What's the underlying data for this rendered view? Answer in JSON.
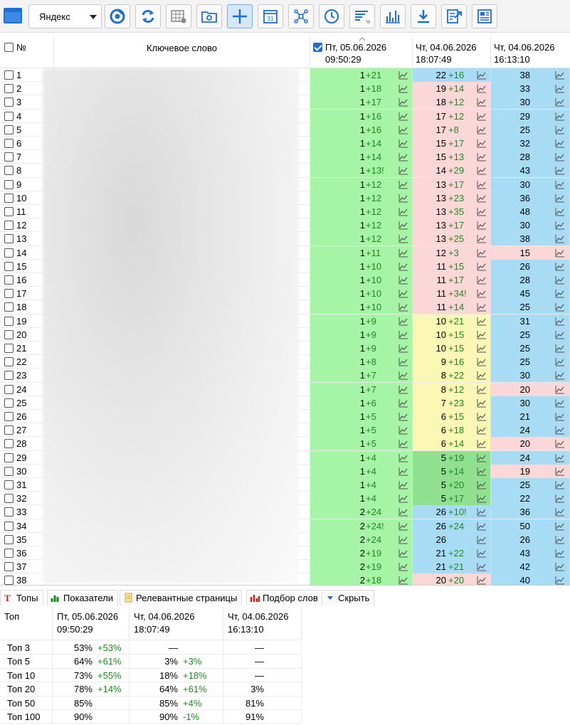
{
  "toolbar": {
    "search_engine": "Яндекс",
    "buttons": [
      "browser-icon",
      "refresh-icon",
      "table-settings-icon",
      "folder-settings-icon",
      "add-icon",
      "calendar-icon",
      "network-icon",
      "clock-icon",
      "filter-percent-icon",
      "chart-settings-icon",
      "download-icon",
      "export-icon",
      "report-icon"
    ],
    "calendar_day": "31"
  },
  "grid": {
    "headers": {
      "num": "№",
      "keyword": "Ключевое слово",
      "p1_date": "Пт, 05.06.2026",
      "p1_time": "09:50:29",
      "p2_date": "Чт, 04.06.2026",
      "p2_time": "18:07:49",
      "p3_date": "Чт, 04.06.2026",
      "p3_time": "16:13:10"
    },
    "rows": [
      {
        "n": "1",
        "p1": "1",
        "d1": "+21",
        "p2": "22",
        "d2": "+16",
        "c2": "blue",
        "p3": "38",
        "c3": "blue"
      },
      {
        "n": "2",
        "p1": "1",
        "d1": "+18",
        "p2": "19",
        "d2": "+14",
        "c2": "pink",
        "p3": "33",
        "c3": "blue"
      },
      {
        "n": "3",
        "p1": "1",
        "d1": "+17",
        "p2": "18",
        "d2": "+12",
        "c2": "pink",
        "p3": "30",
        "c3": "blue"
      },
      {
        "n": "4",
        "p1": "1",
        "d1": "+16",
        "p2": "17",
        "d2": "+12",
        "c2": "pink",
        "p3": "29",
        "c3": "blue"
      },
      {
        "n": "5",
        "p1": "1",
        "d1": "+16",
        "p2": "17",
        "d2": "+8",
        "c2": "pink",
        "p3": "25",
        "c3": "blue"
      },
      {
        "n": "6",
        "p1": "1",
        "d1": "+14",
        "p2": "15",
        "d2": "+17",
        "c2": "pink",
        "p3": "32",
        "c3": "blue"
      },
      {
        "n": "7",
        "p1": "1",
        "d1": "+14",
        "p2": "15",
        "d2": "+13",
        "c2": "pink",
        "p3": "28",
        "c3": "blue"
      },
      {
        "n": "8",
        "p1": "1",
        "d1": "+13!",
        "p2": "14",
        "d2": "+29",
        "c2": "pink",
        "p3": "43",
        "c3": "blue"
      },
      {
        "n": "9",
        "p1": "1",
        "d1": "+12",
        "p2": "13",
        "d2": "+17",
        "c2": "pink",
        "p3": "30",
        "c3": "blue"
      },
      {
        "n": "10",
        "p1": "1",
        "d1": "+12",
        "p2": "13",
        "d2": "+23",
        "c2": "pink",
        "p3": "36",
        "c3": "blue"
      },
      {
        "n": "11",
        "p1": "1",
        "d1": "+12",
        "p2": "13",
        "d2": "+35",
        "c2": "pink",
        "p3": "48",
        "c3": "blue"
      },
      {
        "n": "12",
        "p1": "1",
        "d1": "+12",
        "p2": "13",
        "d2": "+17",
        "c2": "pink",
        "p3": "30",
        "c3": "blue"
      },
      {
        "n": "13",
        "p1": "1",
        "d1": "+12",
        "p2": "13",
        "d2": "+25",
        "c2": "pink",
        "p3": "38",
        "c3": "blue"
      },
      {
        "n": "14",
        "p1": "1",
        "d1": "+11",
        "p2": "12",
        "d2": "+3",
        "c2": "pink",
        "p3": "15",
        "c3": "pink"
      },
      {
        "n": "15",
        "p1": "1",
        "d1": "+10",
        "p2": "11",
        "d2": "+15",
        "c2": "pink",
        "p3": "26",
        "c3": "blue"
      },
      {
        "n": "16",
        "p1": "1",
        "d1": "+10",
        "p2": "11",
        "d2": "+17",
        "c2": "pink",
        "p3": "28",
        "c3": "blue"
      },
      {
        "n": "17",
        "p1": "1",
        "d1": "+10",
        "p2": "11",
        "d2": "+34!",
        "c2": "pink",
        "p3": "45",
        "c3": "blue"
      },
      {
        "n": "18",
        "p1": "1",
        "d1": "+10",
        "p2": "11",
        "d2": "+14",
        "c2": "pink",
        "p3": "25",
        "c3": "blue"
      },
      {
        "n": "19",
        "p1": "1",
        "d1": "+9",
        "p2": "10",
        "d2": "+21",
        "c2": "yellow",
        "p3": "31",
        "c3": "blue"
      },
      {
        "n": "20",
        "p1": "1",
        "d1": "+9",
        "p2": "10",
        "d2": "+15",
        "c2": "yellow",
        "p3": "25",
        "c3": "blue"
      },
      {
        "n": "21",
        "p1": "1",
        "d1": "+9",
        "p2": "10",
        "d2": "+15",
        "c2": "yellow",
        "p3": "25",
        "c3": "blue"
      },
      {
        "n": "22",
        "p1": "1",
        "d1": "+8",
        "p2": "9",
        "d2": "+16",
        "c2": "yellow",
        "p3": "25",
        "c3": "blue"
      },
      {
        "n": "23",
        "p1": "1",
        "d1": "+7",
        "p2": "8",
        "d2": "+22",
        "c2": "yellow",
        "p3": "30",
        "c3": "blue"
      },
      {
        "n": "24",
        "p1": "1",
        "d1": "+7",
        "p2": "8",
        "d2": "+12",
        "c2": "yellow",
        "p3": "20",
        "c3": "pink"
      },
      {
        "n": "25",
        "p1": "1",
        "d1": "+6",
        "p2": "7",
        "d2": "+23",
        "c2": "yellow",
        "p3": "30",
        "c3": "blue"
      },
      {
        "n": "26",
        "p1": "1",
        "d1": "+5",
        "p2": "6",
        "d2": "+15",
        "c2": "yellow",
        "p3": "21",
        "c3": "blue"
      },
      {
        "n": "27",
        "p1": "1",
        "d1": "+5",
        "p2": "6",
        "d2": "+18",
        "c2": "yellow",
        "p3": "24",
        "c3": "blue"
      },
      {
        "n": "28",
        "p1": "1",
        "d1": "+5",
        "p2": "6",
        "d2": "+14",
        "c2": "yellow",
        "p3": "20",
        "c3": "pink"
      },
      {
        "n": "29",
        "p1": "1",
        "d1": "+4",
        "p2": "5",
        "d2": "+19",
        "c2": "dgreen",
        "p3": "24",
        "c3": "blue"
      },
      {
        "n": "30",
        "p1": "1",
        "d1": "+4",
        "p2": "5",
        "d2": "+14",
        "c2": "dgreen",
        "p3": "19",
        "c3": "pink"
      },
      {
        "n": "31",
        "p1": "1",
        "d1": "+4",
        "p2": "5",
        "d2": "+20",
        "c2": "dgreen",
        "p3": "25",
        "c3": "blue"
      },
      {
        "n": "32",
        "p1": "1",
        "d1": "+4",
        "p2": "5",
        "d2": "+17",
        "c2": "dgreen",
        "p3": "22",
        "c3": "blue"
      },
      {
        "n": "33",
        "p1": "2",
        "d1": "+24",
        "p2": "26",
        "d2": "+10!",
        "c2": "blue",
        "p3": "36",
        "c3": "blue"
      },
      {
        "n": "34",
        "p1": "2",
        "d1": "+24!",
        "p2": "26",
        "d2": "+24",
        "c2": "blue",
        "p3": "50",
        "c3": "blue"
      },
      {
        "n": "35",
        "p1": "2",
        "d1": "+24",
        "p2": "26",
        "d2": "",
        "c2": "blue",
        "p3": "26",
        "c3": "blue"
      },
      {
        "n": "36",
        "p1": "2",
        "d1": "+19",
        "p2": "21",
        "d2": "+22",
        "c2": "blue",
        "p3": "43",
        "c3": "blue"
      },
      {
        "n": "37",
        "p1": "2",
        "d1": "+19",
        "p2": "21",
        "d2": "+21",
        "c2": "blue",
        "p3": "42",
        "c3": "blue"
      },
      {
        "n": "38",
        "p1": "2",
        "d1": "+18",
        "p2": "20",
        "d2": "+20",
        "c2": "pink",
        "p3": "40",
        "c3": "blue"
      }
    ]
  },
  "tabs": [
    {
      "label": "Топы",
      "icon": "top-t-icon",
      "active": true
    },
    {
      "label": "Показатели",
      "icon": "bar-chart-icon",
      "active": false
    },
    {
      "label": "Релевантные страницы",
      "icon": "page-icon",
      "active": false
    },
    {
      "label": "Подбор слов",
      "icon": "word-chart-icon",
      "active": false
    },
    {
      "label": "Скрыть",
      "icon": "chevron-down-icon",
      "active": false
    }
  ],
  "tops": {
    "header": {
      "label": "Топ",
      "c1_date": "Пт, 05.06.2026",
      "c1_time": "09:50:29",
      "c2_date": "Чт, 04.06.2026",
      "c2_time": "18:07:49",
      "c3_date": "Чт, 04.06.2026",
      "c3_time": "16:13:10"
    },
    "rows": [
      {
        "label": "Топ 3",
        "v1": "53%",
        "d1": "+53%",
        "v2": "—",
        "d2": "",
        "v3": "—"
      },
      {
        "label": "Топ 5",
        "v1": "64%",
        "d1": "+61%",
        "v2": "3%",
        "d2": "+3%",
        "v3": "—"
      },
      {
        "label": "Топ 10",
        "v1": "73%",
        "d1": "+55%",
        "v2": "18%",
        "d2": "+18%",
        "v3": "—"
      },
      {
        "label": "Топ 20",
        "v1": "78%",
        "d1": "+14%",
        "v2": "64%",
        "d2": "+61%",
        "v3": "3%"
      },
      {
        "label": "Топ 50",
        "v1": "85%",
        "d1": "",
        "v2": "85%",
        "d2": "+4%",
        "v3": "81%"
      },
      {
        "label": "Топ 100",
        "v1": "90%",
        "d1": "",
        "v2": "90%",
        "d2": "-1%",
        "v3": "91%"
      }
    ]
  },
  "colors": {
    "green": "#a6f4a6",
    "pink": "#fcd7d7",
    "blue": "#a8dcf5",
    "yellow": "#fbf7b4",
    "dgreen": "#8fe08f",
    "accent": "#1f6fd1"
  }
}
